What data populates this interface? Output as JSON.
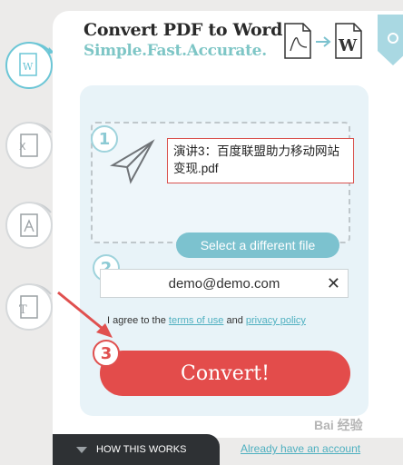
{
  "header": {
    "title": "Convert PDF to Word",
    "subtitle": "Simple.Fast.Accurate."
  },
  "rail": [
    {
      "icon": "word-doc-icon",
      "active": true
    },
    {
      "icon": "excel-doc-icon",
      "active": false
    },
    {
      "icon": "pdf-doc-icon",
      "active": false
    },
    {
      "icon": "text-doc-icon",
      "active": false
    }
  ],
  "steps": {
    "one": "1",
    "two": "2",
    "three": "3"
  },
  "upload": {
    "filename": "演讲3：百度联盟助力移动网站变现.pdf",
    "select_label": "Select a different file"
  },
  "email": {
    "value": "demo@demo.com",
    "clear_glyph": "✕"
  },
  "terms": {
    "prefix": "I agree to the ",
    "terms_link": "terms of use",
    "and": " and ",
    "privacy_link": "privacy policy"
  },
  "convert_label": "Convert!",
  "footer": {
    "how_label": "HOW THIS WORKS",
    "account_link": "Already have an account"
  },
  "watermark": "Bai 经验",
  "colors": {
    "accent_teal": "#7cc2cf",
    "convert_red": "#e34c4b",
    "annotation_red": "#e0504f"
  }
}
